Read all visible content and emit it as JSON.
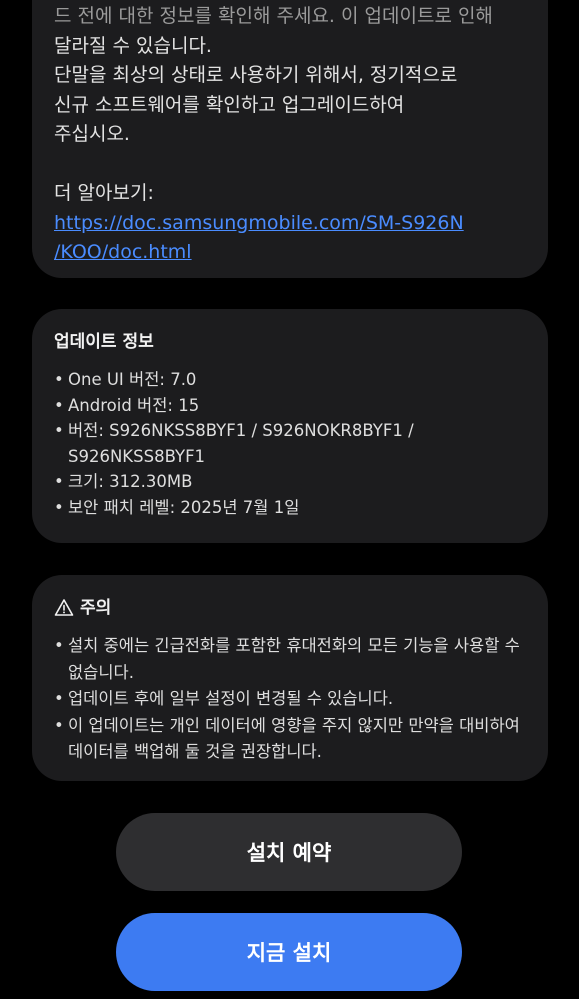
{
  "intro": {
    "partial_line": "드 전에 대한 정보를 확인해 주세요. 이 업데이트로 인해",
    "paragraph": "달라질 수 있습니다.\n단말을 최상의 상태로 사용하기 위해서, 정기적으로\n신규 소프트웨어를 확인하고 업그레이드하여\n주십시오.",
    "learn_more_label": "더 알아보기:",
    "learn_more_url": "https://doc.samsungmobile.com/SM-S926N\n/KOO/doc.html"
  },
  "update_info": {
    "title": "업데이트 정보",
    "items": [
      "One UI 버전: 7.0",
      "Android 버전: 15",
      "버전: S926NKSS8BYF1 / S926NOKR8BYF1 / S926NKSS8BYF1",
      "크기: 312.30MB",
      "보안 패치 레벨: 2025년 7월 1일"
    ]
  },
  "caution": {
    "icon": "warning-triangle-icon",
    "title": "주의",
    "items": [
      "설치 중에는 긴급전화를 포함한 휴대전화의 모든 기능을 사용할 수 없습니다.",
      "업데이트 후에 일부 설정이 변경될 수 있습니다.",
      "이 업데이트는 개인 데이터에 영향을 주지 않지만 만약을 대비하여 데이터를 백업해 둘 것을 권장합니다."
    ]
  },
  "buttons": {
    "schedule_label": "설치 예약",
    "install_label": "지금 설치"
  },
  "colors": {
    "background": "#000000",
    "card": "#1c1c1e",
    "link": "#4a8cff",
    "primary_button": "#3d7bf2",
    "secondary_button": "#2e2e30"
  }
}
